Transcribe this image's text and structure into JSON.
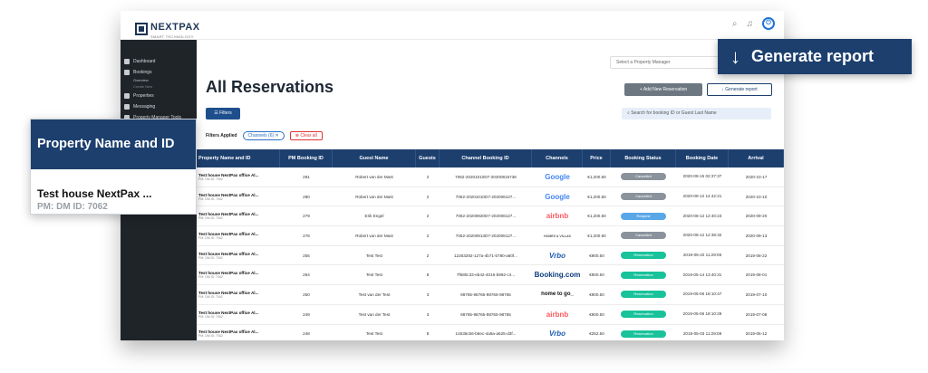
{
  "app": {
    "logo": "NEXTPAX",
    "logo_sub": "SMART TECHNOLOGY"
  },
  "sidebar": {
    "items": [
      {
        "label": "Dashboard"
      },
      {
        "label": "Bookings"
      },
      {
        "label": "Overview"
      },
      {
        "label": "Create New"
      },
      {
        "label": "Properties"
      },
      {
        "label": "Messaging"
      },
      {
        "label": "Property Manager Tools"
      }
    ]
  },
  "header": {
    "pm_placeholder": "Select a Property Manager",
    "title": "All Reservations",
    "add_button": "+ Add New Reservation",
    "generate_button": "Generate report",
    "filters_button": "Filters",
    "search_placeholder": "Search for booking ID or Guest Last Name",
    "filters_applied_label": "Filters Applied",
    "filter_chip": "Channels (6) ✕",
    "clear_all": "Clear all"
  },
  "table": {
    "columns": [
      "Property Name and ID",
      "PM Booking ID",
      "Guest Name",
      "Guests",
      "Channel Booking ID",
      "Channels",
      "Price",
      "Booking Status",
      "Booking Date",
      "Arrival"
    ],
    "rows": [
      {
        "prop": "Test house NextPax office Al...",
        "sub": "PM: DM   ID: 7062",
        "pm_id": "281",
        "guest": "Robert van der Mast",
        "guests": "2",
        "channel_id": "7062-20201010D7-20200815736",
        "channel": "Google",
        "ch_class": "ch-google",
        "price": "€1,200.50",
        "status": "Cancelled",
        "st_class": "st-cancelled",
        "booking_date": "2020-08-15 02:37:37",
        "arrival": "2020-10-17"
      },
      {
        "prop": "Test house NextPax office Al...",
        "sub": "PM: DM   ID: 7062",
        "pm_id": "280",
        "guest": "Robert van der Mast",
        "guests": "2",
        "channel_id": "7062-20201010D7-202008127...",
        "channel": "Google",
        "ch_class": "ch-google",
        "price": "€1,200.50",
        "status": "Cancelled",
        "st_class": "st-cancelled",
        "booking_date": "2020-08-12 14:42:21",
        "arrival": "2020-10-10"
      },
      {
        "prop": "Test house NextPax office Al...",
        "sub": "PM: DM   ID: 7062",
        "pm_id": "279",
        "guest": "Erik Engel",
        "guests": "2",
        "channel_id": "7062-20200920D7-202008127...",
        "channel": "airbnb",
        "ch_class": "ch-airbnb",
        "price": "€1,200.50",
        "status": "Request",
        "st_class": "st-request",
        "booking_date": "2020-08-12 12:40:23",
        "arrival": "2020-09-20"
      },
      {
        "prop": "Test house NextPax office Al...",
        "sub": "PM: DM   ID: 7062",
        "pm_id": "278",
        "guest": "Robert van der Mast",
        "guests": "2",
        "channel_id": "7062-20200913D7-202008127...",
        "channel": "HOMES & VILLAS",
        "ch_class": "ch-homes",
        "price": "€1,200.50",
        "status": "Cancelled",
        "st_class": "st-cancelled",
        "booking_date": "2020-08-12 12:38:32",
        "arrival": "2020-09-13"
      },
      {
        "prop": "Test house NextPax office Al...",
        "sub": "PM: DM   ID: 7062",
        "pm_id": "255",
        "guest": "Test Test",
        "guests": "2",
        "channel_id": "12263292-127a-4b71-b780-a60f...",
        "channel": "Vrbo",
        "ch_class": "ch-vrbo",
        "price": "€900.50",
        "status": "Reservation",
        "st_class": "st-reservation",
        "booking_date": "2019-05-22 11:29:06",
        "arrival": "2019-08-22"
      },
      {
        "prop": "Test house NextPax office Al...",
        "sub": "PM: DM   ID: 7062",
        "pm_id": "254",
        "guest": "Test Test",
        "guests": "8",
        "channel_id": "7f680c33-eb42-4016-b992-c4...",
        "channel": "Booking.com",
        "ch_class": "ch-booking",
        "price": "€900.50",
        "status": "Reservation",
        "st_class": "st-reservation",
        "booking_date": "2019-05-14 13:40:31",
        "arrival": "2019-08-01"
      },
      {
        "prop": "Test house NextPax office Al...",
        "sub": "PM: DM   ID: 7062",
        "pm_id": "250",
        "guest": "Test van der Test",
        "guests": "3",
        "channel_id": "98765-98765-98765-98765",
        "channel": "home to go_",
        "ch_class": "ch-home",
        "price": "€900.50",
        "status": "Reservation",
        "st_class": "st-reservation",
        "booking_date": "2019-05-06 18:10:47",
        "arrival": "2019-07-10"
      },
      {
        "prop": "Test house NextPax office Al...",
        "sub": "PM: DM   ID: 7062",
        "pm_id": "249",
        "guest": "Test van der Test",
        "guests": "3",
        "channel_id": "98765-98765-98765-98765",
        "channel": "airbnb",
        "ch_class": "ch-airbnb",
        "price": "€900.50",
        "status": "Reservation",
        "st_class": "st-reservation",
        "booking_date": "2019-05-06 18:10:29",
        "arrival": "2019-07-08"
      },
      {
        "prop": "Test house NextPax office Al...",
        "sub": "PM: DM   ID: 7062",
        "pm_id": "248",
        "guest": "Test Test",
        "guests": "8",
        "channel_id": "14535cb6-b8ec-4a9a-a525-d3f...",
        "channel": "Vrbo",
        "ch_class": "ch-vrbo",
        "price": "€252.50",
        "status": "Reservation",
        "st_class": "st-reservation",
        "booking_date": "2019-05-03 11:29:08",
        "arrival": "2019-06-12"
      },
      {
        "prop": "Test house NextPax office Al...",
        "sub": "",
        "pm_id": "",
        "guest": "",
        "guests": "",
        "channel_id": "",
        "channel": "",
        "ch_class": "",
        "price": "",
        "status": "",
        "st_class": "",
        "booking_date": "",
        "arrival": ""
      }
    ]
  },
  "callout": {
    "heading": "Property Name and ID",
    "name": "Test house NextPax ...",
    "sub": "PM: DM   ID: 7062"
  },
  "generate_callout": {
    "label": "Generate report"
  }
}
